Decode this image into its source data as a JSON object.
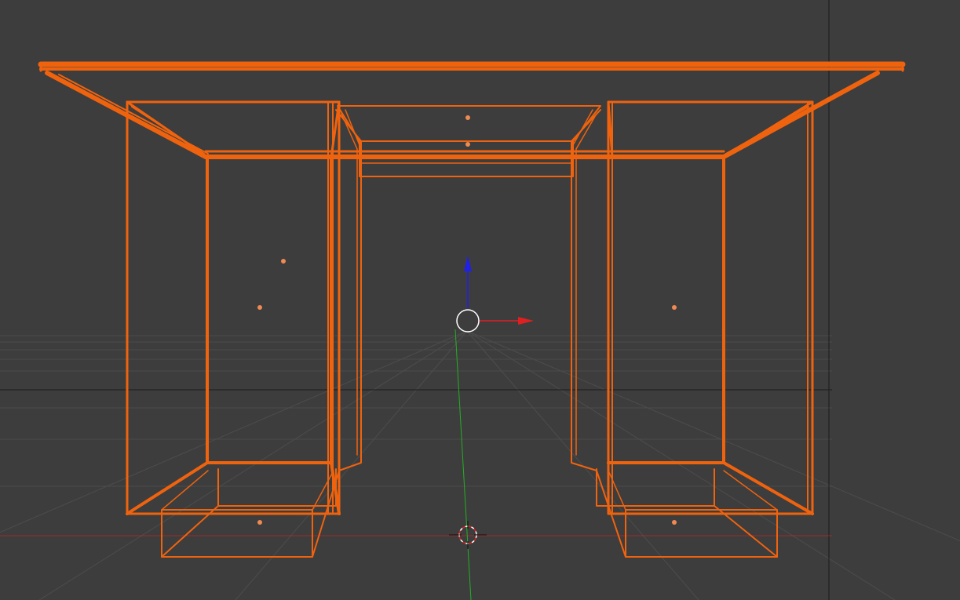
{
  "viewport": {
    "background_color": "#3d3d3d",
    "grid_color": "#595959",
    "horizon_color": "#1c1c1c",
    "selection_color": "#f0630e",
    "origin_dot_color": "#f08a50",
    "x_axis_color": "#e02020",
    "y_axis_color": "#22b022",
    "z_axis_color": "#2020e8",
    "gizmo_ring_color": "#ffffff"
  },
  "scene": {
    "object": "desk",
    "display_mode": "wireframe",
    "selected": true
  },
  "icons": {
    "transform_gizmo": "translate-gizmo-icon",
    "cursor_3d": "3d-cursor-icon"
  }
}
